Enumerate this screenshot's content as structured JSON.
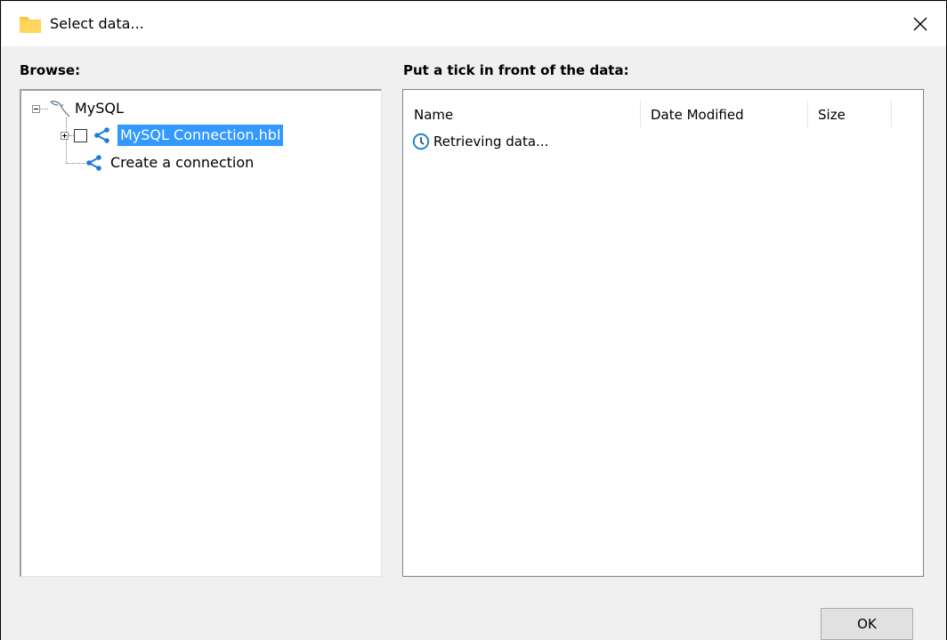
{
  "window": {
    "title": "Select data...",
    "icon": "folder-icon",
    "close_icon": "close-icon"
  },
  "browse": {
    "label": "Browse:",
    "tree": {
      "root": {
        "label": "MySQL",
        "icon": "mysql-dolphin-icon",
        "expanded": true
      },
      "children": [
        {
          "label": "MySQL Connection.hbl",
          "icon": "share-connection-icon",
          "checked": false,
          "selected": true,
          "expandable": true
        },
        {
          "label": "Create a connection",
          "icon": "share-connection-icon"
        }
      ]
    }
  },
  "data_panel": {
    "label": "Put a tick in front of the data:",
    "columns": [
      "Name",
      "Date Modified",
      "Size"
    ],
    "status": {
      "text": "Retrieving data...",
      "icon": "clock-icon"
    }
  },
  "footer": {
    "ok_label": "OK"
  },
  "colors": {
    "selection": "#3399ff",
    "folder": "#ffc83d",
    "connection_icon": "#1e7ad6",
    "clock_icon": "#1f86c8"
  }
}
